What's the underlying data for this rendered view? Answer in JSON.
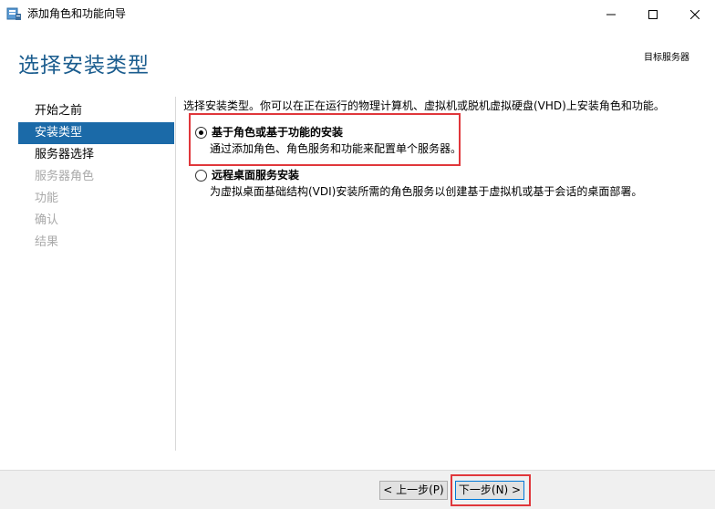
{
  "window": {
    "title": "添加角色和功能向导",
    "icon": "server-manager-icon"
  },
  "header": {
    "page_title": "选择安装类型",
    "target_server_label": "目标服务器"
  },
  "nav": {
    "items": [
      {
        "label": "开始之前",
        "state": "normal"
      },
      {
        "label": "安装类型",
        "state": "active"
      },
      {
        "label": "服务器选择",
        "state": "normal"
      },
      {
        "label": "服务器角色",
        "state": "disabled"
      },
      {
        "label": "功能",
        "state": "disabled"
      },
      {
        "label": "确认",
        "state": "disabled"
      },
      {
        "label": "结果",
        "state": "disabled"
      }
    ]
  },
  "content": {
    "intro": "选择安装类型。你可以在正在运行的物理计算机、虚拟机或脱机虚拟硬盘(VHD)上安装角色和功能。",
    "options": [
      {
        "title": "基于角色或基于功能的安装",
        "description": "通过添加角色、角色服务和功能来配置单个服务器。",
        "selected": true
      },
      {
        "title": "远程桌面服务安装",
        "description": "为虚拟桌面基础结构(VDI)安装所需的角色服务以创建基于虚拟机或基于会话的桌面部署。",
        "selected": false
      }
    ]
  },
  "footer": {
    "prev_label": "< 上一步(P)",
    "next_label": "下一步(N) >"
  },
  "colors": {
    "accent": "#1b6aa8",
    "title": "#1a5c8e",
    "highlight": "#e0373b"
  }
}
